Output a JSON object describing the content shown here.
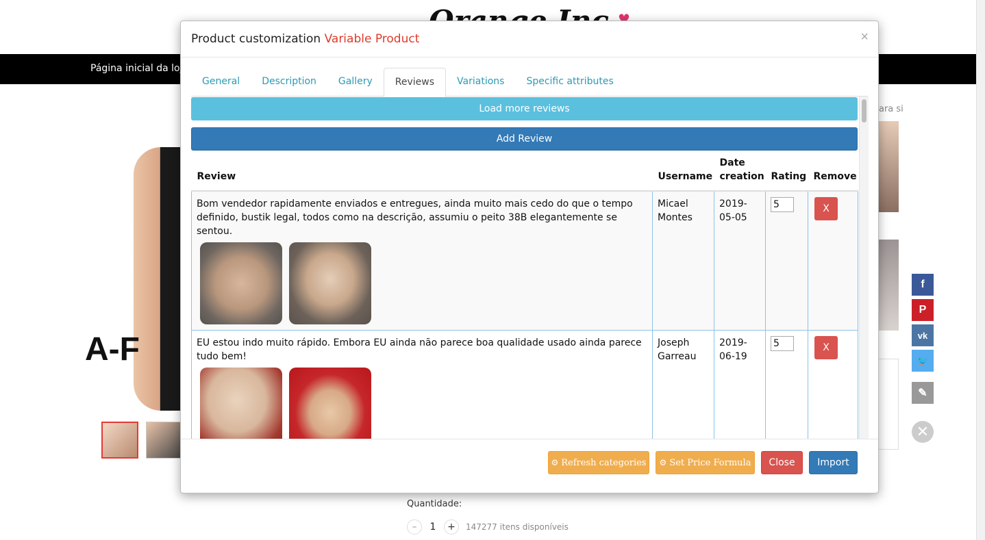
{
  "background": {
    "logo": "Orange Inc",
    "nav_home": "Página inicial da loja",
    "product_overlay_text": "A-F",
    "side_text": "ara si",
    "quantity_label": "Quantidade:",
    "quantity_value": "1",
    "available": "147277 itens disponíveis",
    "share": [
      {
        "name": "facebook-icon",
        "glyph": "f",
        "color": "#3b5998"
      },
      {
        "name": "pinterest-icon",
        "glyph": "P",
        "color": "#cb2027"
      },
      {
        "name": "vk-icon",
        "glyph": "vk",
        "color": "#4c75a3"
      },
      {
        "name": "twitter-icon",
        "glyph": "🐦",
        "color": "#55acee"
      },
      {
        "name": "pen-icon",
        "glyph": "✎",
        "color": "#999999"
      }
    ]
  },
  "modal": {
    "title": "Product customization",
    "title_accent": "Variable Product",
    "close_glyph": "×",
    "tabs": [
      "General",
      "Description",
      "Gallery",
      "Reviews",
      "Variations",
      "Specific attributes"
    ],
    "active_tab": "Reviews",
    "load_more": "Load more reviews",
    "add_review": "Add Review",
    "table": {
      "headers": [
        "Review",
        "Username",
        "Date creation",
        "Rating",
        "Remove"
      ],
      "rows": [
        {
          "review": "Bom vendedor rapidamente enviados e entregues, ainda muito mais cedo do que o tempo definido, bustik legal, todos como na descrição, assumiu o peito 38B elegantemente se sentou.",
          "username": "Micael Montes",
          "date": "2019-05-05",
          "rating": "5",
          "remove": "X"
        },
        {
          "review": "EU estou indo muito rápido. Embora EU ainda não parece boa qualidade usado ainda parece tudo bem!",
          "username": "Joseph Garreau",
          "date": "2019-06-19",
          "rating": "5",
          "remove": "X"
        }
      ]
    },
    "footer": {
      "refresh": "Refresh categories",
      "price": "Set Price Formula",
      "close": "Close",
      "import": "Import"
    }
  },
  "colors": {
    "accent_red": "#e03a2b",
    "info": "#5bc0de",
    "primary": "#337ab7",
    "warning": "#f0ad4e",
    "danger": "#d9534f",
    "tab_link": "#2a9bb5"
  }
}
